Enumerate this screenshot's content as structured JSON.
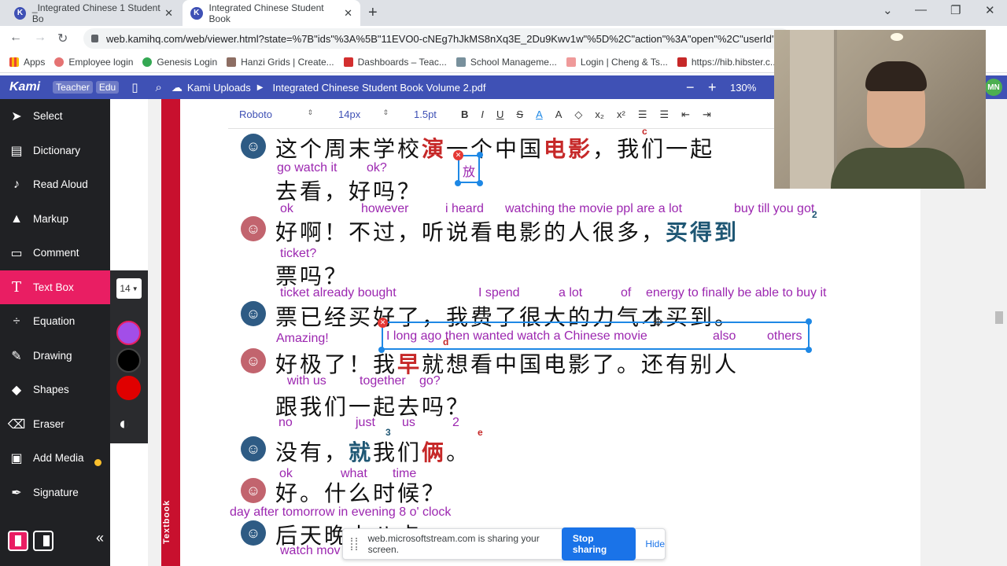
{
  "browser": {
    "tabs": [
      {
        "title": "_Integrated Chinese 1 Student Bo",
        "icon": "kami-icon"
      },
      {
        "title": "Integrated Chinese Student Book",
        "icon": "kami-icon"
      }
    ],
    "url": "web.kamihq.com/web/viewer.html?state=%7B\"ids\"%3A%5B\"11EVO0-cNEg7hJkMS8nXq3E_2Du9Kwv1w\"%5D%2C\"action\"%3A\"open\"%2C\"userId\"%3",
    "bookmarks": [
      "Apps",
      "Employee login",
      "Genesis Login",
      "Hanzi Grids | Create...",
      "Dashboards – Teac...",
      "School Manageme...",
      "Login | Cheng & Ts...",
      "https://hib.hibster.c..."
    ]
  },
  "kami": {
    "logo": "Kami",
    "roles": [
      "Teacher",
      "Edu"
    ],
    "breadcrumb_root": "Kami Uploads",
    "file_name": "Integrated Chinese Student Book Volume 2.pdf",
    "zoom": "130%",
    "user_initials": "MN"
  },
  "tools": [
    {
      "label": "Select",
      "icon": "cursor-icon"
    },
    {
      "label": "Dictionary",
      "icon": "book-icon"
    },
    {
      "label": "Read Aloud",
      "icon": "speaker-icon"
    },
    {
      "label": "Markup",
      "icon": "highlighter-icon"
    },
    {
      "label": "Comment",
      "icon": "comment-icon"
    },
    {
      "label": "Text Box",
      "icon": "text-icon",
      "active": true
    },
    {
      "label": "Equation",
      "icon": "divide-icon"
    },
    {
      "label": "Drawing",
      "icon": "brush-icon"
    },
    {
      "label": "Shapes",
      "icon": "shapes-icon"
    },
    {
      "label": "Eraser",
      "icon": "eraser-icon"
    },
    {
      "label": "Add Media",
      "icon": "media-icon",
      "badge": true
    },
    {
      "label": "Signature",
      "icon": "pen-icon"
    }
  ],
  "textbox_options": {
    "font_size": "14",
    "colors": [
      "#a24ee8",
      "#000000",
      "#e00000"
    ]
  },
  "format_bar": {
    "font": "Roboto",
    "size": "14px",
    "stroke": "1.5pt",
    "buttons": [
      "B",
      "I",
      "U",
      "S",
      "A",
      "A",
      "x₂",
      "x²"
    ]
  },
  "dialogue": [
    {
      "speaker": "boy",
      "zh": [
        "这个周末学校",
        "演",
        "一个中国",
        "电影",
        "，我们一起"
      ],
      "ann": [
        "go watch it",
        "ok?"
      ]
    },
    {
      "zh": [
        "去看，好吗？"
      ]
    },
    {
      "speaker": "girl",
      "zh": [
        "好啊！不过，听说看电影的人很多，",
        "买得到"
      ],
      "ann": [
        "ok",
        "however",
        "i heard",
        "watching the movie ppl are a lot",
        "buy till you got"
      ]
    },
    {
      "zh": [
        "票吗？"
      ],
      "ann": [
        "ticket?"
      ]
    },
    {
      "speaker": "boy",
      "zh": [
        "票已经买好了，我费了很大的力气才买到。"
      ],
      "ann": [
        "ticket already bought",
        "I spend",
        "a lot",
        "of",
        "energy to finally be able to buy it"
      ]
    },
    {
      "speaker": "girl",
      "zh": [
        "好极了！我",
        "早",
        "就想看中国电影了。还有别人"
      ],
      "ann": [
        "Amazing!"
      ]
    },
    {
      "zh": [
        "跟我们一起去吗？"
      ],
      "ann": [
        "with us",
        "together",
        "go?"
      ]
    },
    {
      "speaker": "boy",
      "zh": [
        "没有，",
        "就",
        "我们",
        "俩",
        "。"
      ],
      "ann": [
        "no",
        "just",
        "us",
        "2"
      ]
    },
    {
      "speaker": "girl",
      "zh": [
        "好。什么时候？"
      ],
      "ann": [
        "ok",
        "what",
        "time"
      ]
    },
    {
      "speaker": "boy",
      "zh": [
        "后天晚上八点"
      ],
      "ann": [
        "day after tomorrow in evening 8 o' clock",
        "watch mov"
      ]
    }
  ],
  "floating_boxes": {
    "small_box_text": "放",
    "active_box_text": "I long ago then wanted watch a Chinese movie",
    "active_box_also": "also",
    "active_box_others": "others"
  },
  "share_bar": {
    "message": "web.microsoftstream.com is sharing your screen.",
    "stop": "Stop sharing",
    "hide": "Hide"
  },
  "page_side_label": "Textbook"
}
